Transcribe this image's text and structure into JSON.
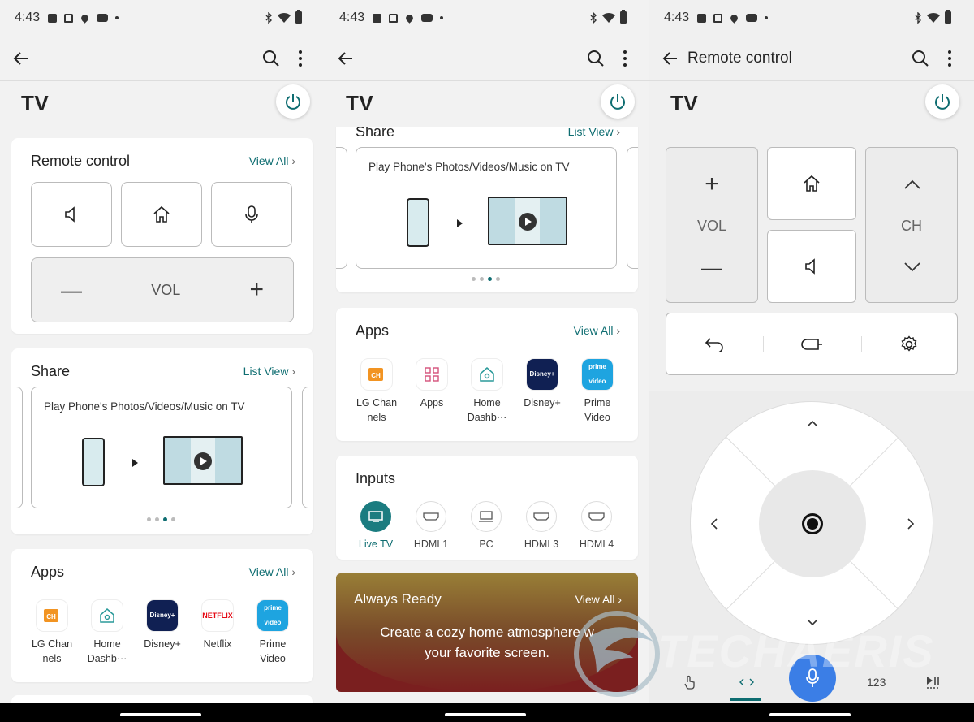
{
  "status": {
    "time": "4:43"
  },
  "panel1": {
    "tv_title": "TV",
    "remote_card": {
      "title": "Remote control",
      "link": "View All",
      "vol_label": "VOL"
    },
    "share_card": {
      "title": "Share",
      "link": "List View",
      "text": "Play Phone's Photos/Videos/Music on TV"
    },
    "apps_card": {
      "title": "Apps",
      "link": "View All",
      "apps": [
        {
          "label": "LG Chan nels",
          "icon": "lg-channels-icon"
        },
        {
          "label": "Home Dashb···",
          "icon": "home-dashboard-icon"
        },
        {
          "label": "Disney+",
          "icon": "disney-plus-icon",
          "icon_text": "Disney+"
        },
        {
          "label": "Netflix",
          "icon": "netflix-icon",
          "icon_text": "NETFLIX"
        },
        {
          "label": "Prime Video",
          "icon": "prime-video-icon",
          "icon_text": "prime video"
        }
      ]
    }
  },
  "panel2": {
    "tv_title": "TV",
    "share_card": {
      "title": "Share",
      "link": "List View",
      "text": "Play Phone's Photos/Videos/Music on TV"
    },
    "apps_card": {
      "title": "Apps",
      "link": "View All",
      "apps": [
        {
          "label": "LG Chan nels",
          "icon": "lg-channels-icon"
        },
        {
          "label": "Apps",
          "icon": "apps-grid-icon"
        },
        {
          "label": "Home Dashb···",
          "icon": "home-dashboard-icon"
        },
        {
          "label": "Disney+",
          "icon": "disney-plus-icon",
          "icon_text": "Disney+"
        },
        {
          "label": "Prime Video",
          "icon": "prime-video-icon",
          "icon_text": "prime video"
        }
      ]
    },
    "inputs_card": {
      "title": "Inputs",
      "inputs": [
        {
          "label": "Live TV",
          "active": true
        },
        {
          "label": "HDMI 1"
        },
        {
          "label": "PC"
        },
        {
          "label": "HDMI 3"
        },
        {
          "label": "HDMI 4"
        }
      ]
    },
    "always_ready": {
      "title": "Always Ready",
      "link": "View All",
      "line1": "Create a cozy home atmosphere w",
      "line2": "your favorite screen."
    }
  },
  "panel3": {
    "appbar_title": "Remote control",
    "tv_title": "TV",
    "vol_label": "VOL",
    "ch_label": "CH",
    "bottom_num": "123"
  },
  "watermark": "TECHAERIS",
  "colors": {
    "accent": "#0e6d71",
    "mic": "#3b7ee6",
    "always_ready_bg": "#7a1f1f"
  }
}
